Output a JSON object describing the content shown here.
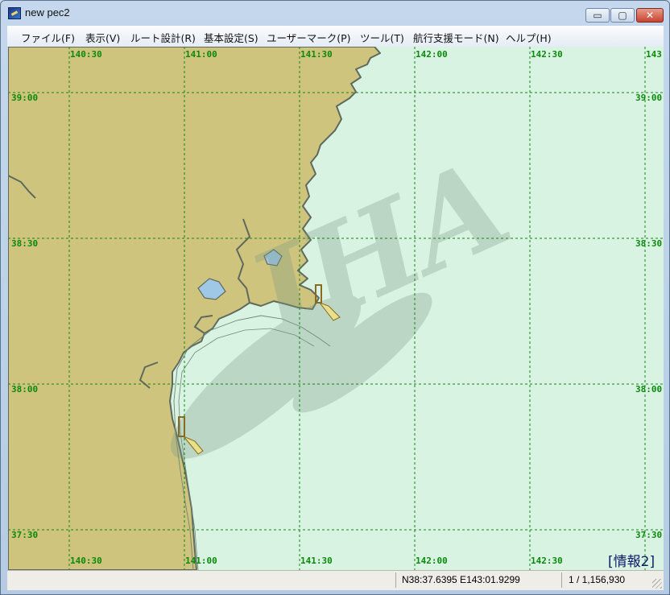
{
  "window": {
    "title": "new pec2"
  },
  "controls": {
    "minimize": "▭",
    "maximize": "▢",
    "close": "✕"
  },
  "menu": [
    "ファイル(F)",
    "表示(V)",
    "ルート設計(R)",
    "基本設定(S)",
    "ユーザーマーク(P)",
    "ツール(T)",
    "航行支援モード(N)",
    "ヘルプ(H)"
  ],
  "map": {
    "colors": {
      "sea": "#d9f3e3",
      "land": "#cfc47d",
      "coast": "#5f6a5d",
      "grid": "#118811",
      "label": "#0a8a0a",
      "shallow": "#e6f6ea"
    },
    "watermark": "JHA",
    "info_label": "[情報2]",
    "lon_labels": [
      "140:30",
      "141:00",
      "141:30",
      "142:00",
      "142:30",
      "143"
    ],
    "lat_labels": [
      "39:00",
      "38:30",
      "38:00",
      "37:30"
    ]
  },
  "status": {
    "coords": "N38:37.6395 E143:01.9299",
    "scale": "1 / 1,156,930"
  }
}
